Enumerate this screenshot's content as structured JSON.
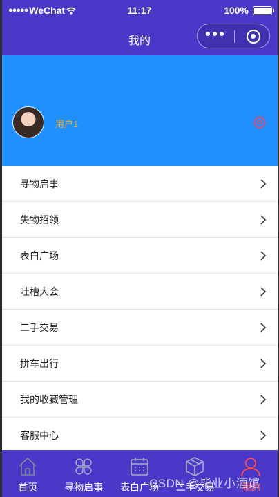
{
  "status_bar": {
    "carrier": "WeChat",
    "time": "11:17",
    "battery": "100%"
  },
  "nav": {
    "title": "我的"
  },
  "profile": {
    "username": "用户1"
  },
  "menu": [
    {
      "label": "寻物启事"
    },
    {
      "label": "失物招领"
    },
    {
      "label": "表白广场"
    },
    {
      "label": "吐槽大会"
    },
    {
      "label": "二手交易"
    },
    {
      "label": "拼车出行"
    },
    {
      "label": "我的收藏管理"
    },
    {
      "label": "客服中心"
    }
  ],
  "tabs": [
    {
      "label": "首页",
      "icon": "home-icon"
    },
    {
      "label": "寻物启事",
      "icon": "clover-icon"
    },
    {
      "label": "表白广场",
      "icon": "calendar-icon"
    },
    {
      "label": "二手交易",
      "icon": "box-icon"
    },
    {
      "label": "我的",
      "icon": "user-icon"
    }
  ],
  "watermark": "CSDN @毕业小酒馆",
  "colors": {
    "header": "#4a38c9",
    "profile_bg": "#1e90ff",
    "username": "#f5a623",
    "gear": "#e8477a",
    "active_tab": "#ff5a5a"
  }
}
